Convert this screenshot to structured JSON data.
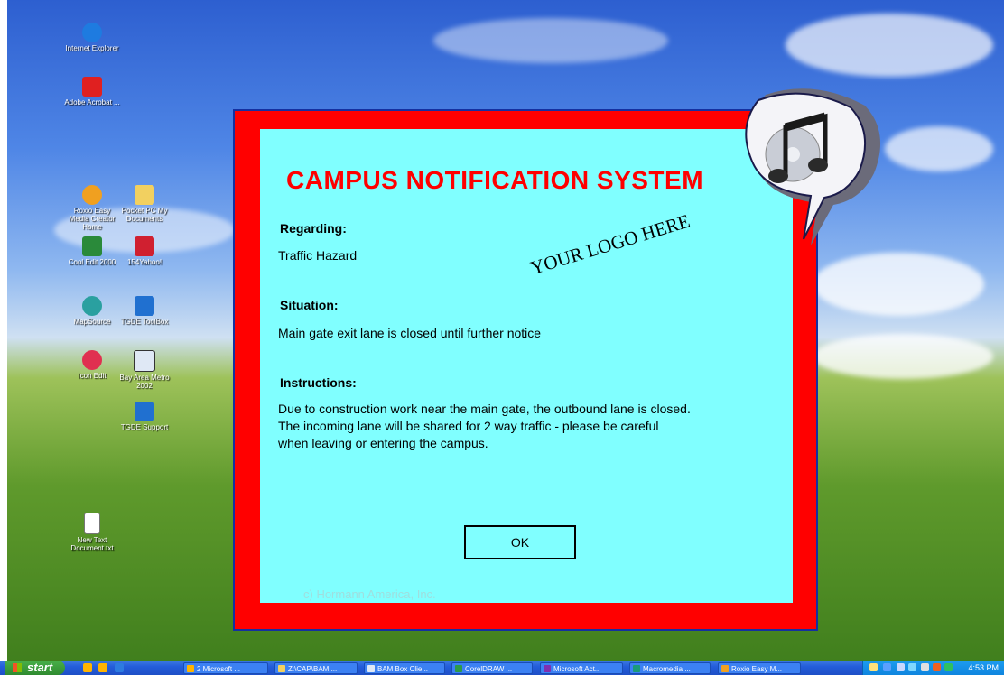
{
  "desktop": {
    "icons": [
      {
        "label": "Internet Explorer",
        "icon": "internet-explorer-icon",
        "color": "#1e7be0"
      },
      {
        "label": "Adobe Acrobat ...",
        "icon": "adobe-acrobat-icon",
        "color": "#e02020"
      },
      {
        "label": "Roxio Easy Media Creator Home",
        "icon": "roxio-icon",
        "color": "#f0a020"
      },
      {
        "label": "Pocket PC My Documents",
        "icon": "folder-icon",
        "color": "#f2d060"
      },
      {
        "label": "Cool Edit 2000",
        "icon": "cool-edit-icon",
        "color": "#2a8a3a"
      },
      {
        "label": "154Yahoo!",
        "icon": "yahoo-icon",
        "color": "#d02030"
      },
      {
        "label": "MapSource",
        "icon": "mapsource-icon",
        "color": "#2aa0a0"
      },
      {
        "label": "TGDE ToolBox",
        "icon": "ie-shortcut-icon",
        "color": "#2070d0"
      },
      {
        "label": "Icon Edit",
        "icon": "icon-edit-icon",
        "color": "#e03050"
      },
      {
        "label": "Bay Area Metro 2002",
        "icon": "application-window-icon",
        "color": "#dfe8f5"
      },
      {
        "label": "TGDE Support",
        "icon": "ie-shortcut-icon",
        "color": "#2070d0"
      },
      {
        "label": "New Text Document.txt",
        "icon": "text-document-icon",
        "color": "#ffffff"
      }
    ]
  },
  "dialog": {
    "title": "CAMPUS NOTIFICATION SYSTEM",
    "regarding_label": "Regarding:",
    "regarding_value": "Traffic Hazard",
    "situation_label": "Situation:",
    "situation_value": "Main gate exit lane is closed until further notice",
    "instructions_label": "Instructions:",
    "instructions_lines": [
      "Due to construction work near the main gate, the outbound lane is closed.",
      "The incoming lane will be shared for 2 way traffic - please be careful",
      "when leaving or entering the campus."
    ],
    "logo_placeholder": "YOUR LOGO HERE",
    "ok_label": "OK",
    "copyright": "c) Hormann America, Inc.",
    "colors": {
      "frame": "#ff0000",
      "panel": "#80ffff",
      "title": "#ff0000"
    },
    "badge_icon": "music-note-icon"
  },
  "taskbar": {
    "start_label": "start",
    "buttons": [
      "2 Microsoft ...",
      "Z:\\CAP\\BAM ...",
      "BAM Box Clie...",
      "CorelDRAW ...",
      "Microsoft Act...",
      "Macromedia ...",
      "Roxio Easy M..."
    ],
    "clock": "4:53 PM"
  }
}
